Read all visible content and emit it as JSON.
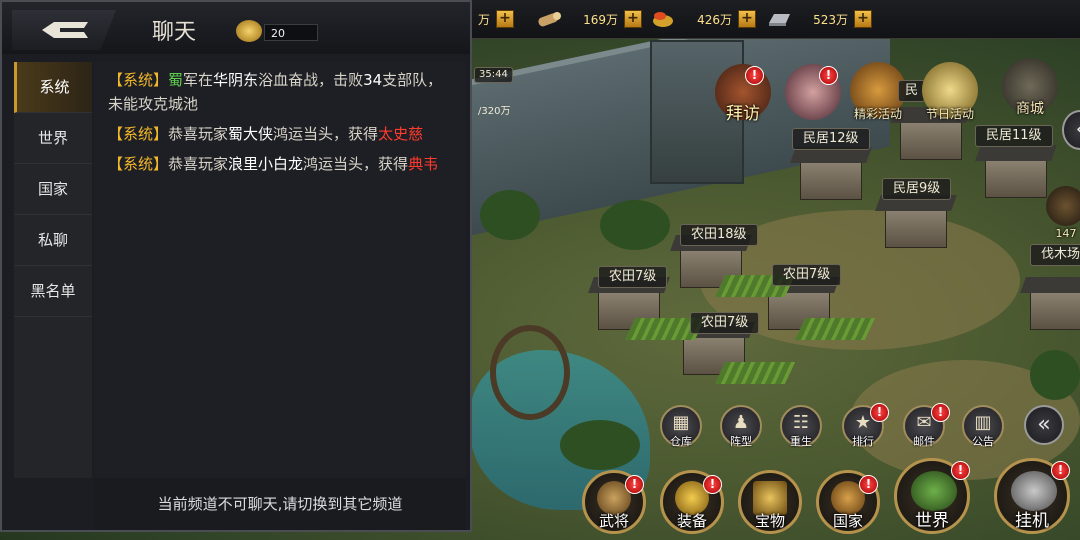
{
  "resources": [
    {
      "icon": "wood-log-icon",
      "value": "169万"
    },
    {
      "icon": "grain-icon",
      "value": "426万"
    },
    {
      "icon": "iron-ingot-icon",
      "value": "523万"
    }
  ],
  "resource_partial": "万",
  "partial_timer": "35:44",
  "partial_stat": "/320万",
  "events": {
    "visit": "拜访",
    "festival": "节日活动",
    "special": "精彩活动",
    "shop": "商城",
    "minju_partial": "民"
  },
  "buildings": {
    "minju12": "民居12级",
    "minju11": "民居11级",
    "minju9": "民居9级",
    "nongtian18": "农田18级",
    "nongtian7_a": "农田7级",
    "nongtian7_b": "农田7级",
    "nongtian7_c": "农田7级",
    "famuchang": "伐木场",
    "partial_count": "147"
  },
  "quick_buttons": [
    "仓库",
    "阵型",
    "重生",
    "排行",
    "邮件",
    "公告"
  ],
  "bottom_buttons": [
    "武将",
    "装备",
    "宝物",
    "国家",
    "世界",
    "挂机"
  ],
  "badge_symbol": "!",
  "side_arrow_symbol": "«",
  "chat": {
    "title": "聊天",
    "horn_count": "20",
    "tabs": [
      "系统",
      "世界",
      "国家",
      "私聊",
      "黑名单"
    ],
    "messages": [
      [
        {
          "c": "sys",
          "t": "【系统】"
        },
        {
          "c": "g",
          "t": "蜀"
        },
        {
          "c": "n",
          "t": "军在"
        },
        {
          "c": "w",
          "t": "华阴东"
        },
        {
          "c": "n",
          "t": "浴血奋战，击败"
        },
        {
          "c": "w",
          "t": "34"
        },
        {
          "c": "n",
          "t": "支部队，未能攻克城池"
        }
      ],
      [
        {
          "c": "sys",
          "t": "【系统】"
        },
        {
          "c": "n",
          "t": "恭喜玩家"
        },
        {
          "c": "w",
          "t": "蜀大侠"
        },
        {
          "c": "n",
          "t": "鸿运当头，获得"
        },
        {
          "c": "r",
          "t": "太史慈"
        }
      ],
      [
        {
          "c": "sys",
          "t": "【系统】"
        },
        {
          "c": "n",
          "t": "恭喜玩家"
        },
        {
          "c": "w",
          "t": "浪里小白龙"
        },
        {
          "c": "n",
          "t": "鸿运当头，获得"
        },
        {
          "c": "r",
          "t": "典韦"
        }
      ]
    ],
    "footer": "当前频道不可聊天,请切换到其它频道"
  }
}
